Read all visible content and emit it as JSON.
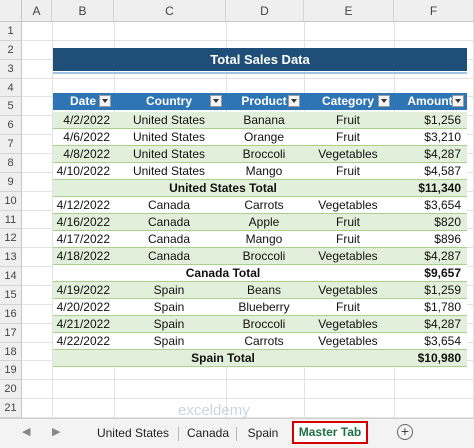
{
  "columns": [
    "A",
    "B",
    "C",
    "D",
    "E",
    "F"
  ],
  "rows": [
    "1",
    "2",
    "3",
    "4",
    "5",
    "6",
    "7",
    "8",
    "9",
    "10",
    "11",
    "12",
    "13",
    "14",
    "15",
    "16",
    "17",
    "18",
    "19",
    "20",
    "21"
  ],
  "title": "Total Sales Data",
  "table_headers": [
    "Date",
    "Country",
    "Product",
    "Category",
    "Amount"
  ],
  "data_rows": [
    {
      "date": "4/2/2022",
      "country": "United States",
      "product": "Banana",
      "category": "Fruit",
      "amount": "$1,256"
    },
    {
      "date": "4/6/2022",
      "country": "United States",
      "product": "Orange",
      "category": "Fruit",
      "amount": "$3,210"
    },
    {
      "date": "4/8/2022",
      "country": "United States",
      "product": "Broccoli",
      "category": "Vegetables",
      "amount": "$4,287"
    },
    {
      "date": "4/10/2022",
      "country": "United States",
      "product": "Mango",
      "category": "Fruit",
      "amount": "$4,587"
    },
    {
      "total": true,
      "label": "United States Total",
      "amount": "$11,340"
    },
    {
      "date": "4/12/2022",
      "country": "Canada",
      "product": "Carrots",
      "category": "Vegetables",
      "amount": "$3,654"
    },
    {
      "date": "4/16/2022",
      "country": "Canada",
      "product": "Apple",
      "category": "Fruit",
      "amount": "$820"
    },
    {
      "date": "4/17/2022",
      "country": "Canada",
      "product": "Mango",
      "category": "Fruit",
      "amount": "$896"
    },
    {
      "date": "4/18/2022",
      "country": "Canada",
      "product": "Broccoli",
      "category": "Vegetables",
      "amount": "$4,287"
    },
    {
      "total": true,
      "label": "Canada  Total",
      "amount": "$9,657"
    },
    {
      "date": "4/19/2022",
      "country": "Spain",
      "product": "Beans",
      "category": "Vegetables",
      "amount": "$1,259"
    },
    {
      "date": "4/20/2022",
      "country": "Spain",
      "product": "Blueberry",
      "category": "Fruit",
      "amount": "$1,780"
    },
    {
      "date": "4/21/2022",
      "country": "Spain",
      "product": "Broccoli",
      "category": "Vegetables",
      "amount": "$4,287"
    },
    {
      "date": "4/22/2022",
      "country": "Spain",
      "product": "Carrots",
      "category": "Vegetables",
      "amount": "$3,654"
    },
    {
      "total": true,
      "label": "Spain  Total",
      "amount": "$10,980"
    }
  ],
  "sheet_tabs": {
    "nav_prev": "◀",
    "nav_next": "▶",
    "tabs": [
      "United States",
      "Canada",
      "Spain",
      "Master Tab"
    ],
    "active": "Master Tab",
    "add_symbol": "+"
  },
  "watermark": "exceldemy",
  "colors": {
    "title_bg": "#1f4e79",
    "header_bg": "#2e75b6",
    "band": "#e2efda",
    "active_tab_border": "#d40000",
    "active_tab_text": "#1e7145"
  }
}
